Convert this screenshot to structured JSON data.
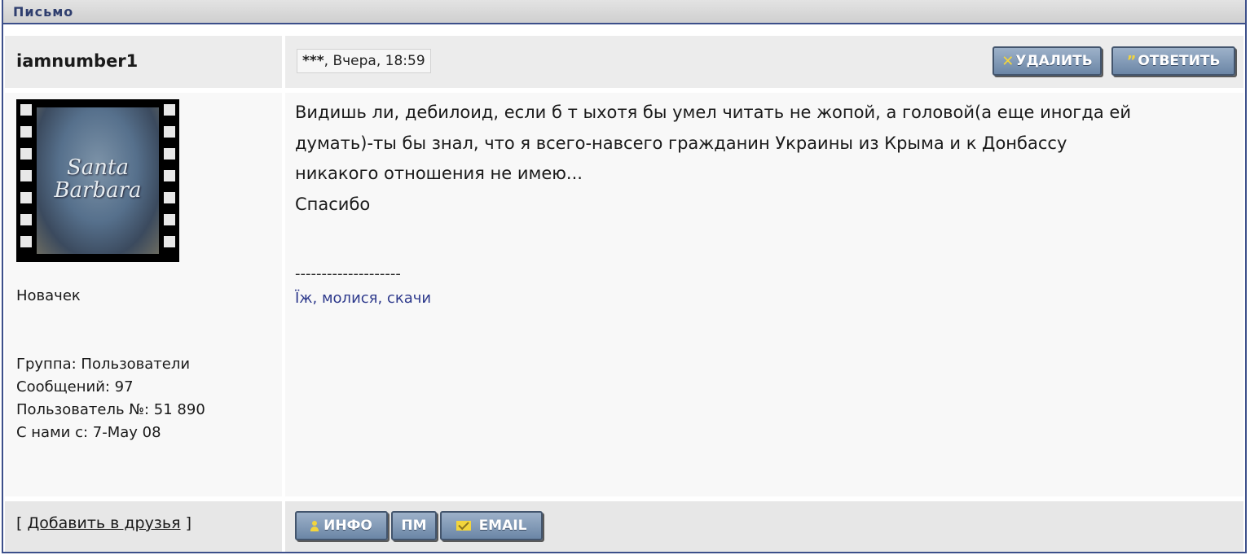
{
  "window": {
    "title": "Письмо"
  },
  "post": {
    "author": "iamnumber1",
    "meta_prefix": "***",
    "meta_date": ", Вчера, 18:59",
    "buttons": {
      "delete_label": "УДАЛИТЬ",
      "reply_label": "ОТВЕТИТЬ"
    },
    "body": [
      "Видишь ли, дебилоид, если б т ыхотя бы умел читать не жопой, а головой(а еще иногда ей",
      "думать)-ты бы знал, что я всего-навсего гражданин Украины из Крыма и к Донбассу",
      "никакого отношения не имею...",
      "Спасибо"
    ],
    "signature": {
      "separator": "--------------------",
      "link_text": "Їж, молися, скачи"
    }
  },
  "user": {
    "avatar_text_line1": "Santa",
    "avatar_text_line2": "Barbara",
    "rank": "Новачек",
    "stats": [
      "Группа: Пользователи",
      "Сообщений: 97",
      "Пользователь №: 51 890",
      "С нами с: 7-May 08"
    ],
    "add_friend": {
      "open": "[ ",
      "link": "Добавить в друзья",
      "close": " ]"
    }
  },
  "footer_buttons": {
    "info_label": "ИНФО",
    "pm_label": "ПМ",
    "email_label": "EMAIL"
  },
  "colors": {
    "border": "#3c4f8a",
    "title_text": "#2f3e6e",
    "signature_link": "#2e3a8c",
    "button_top": "#9db1c9",
    "button_bottom": "#6b86a6",
    "icon_accent": "#f3d53c"
  },
  "icons": [
    "delete-x-icon",
    "quote-icon",
    "person-icon",
    "mail-icon"
  ]
}
